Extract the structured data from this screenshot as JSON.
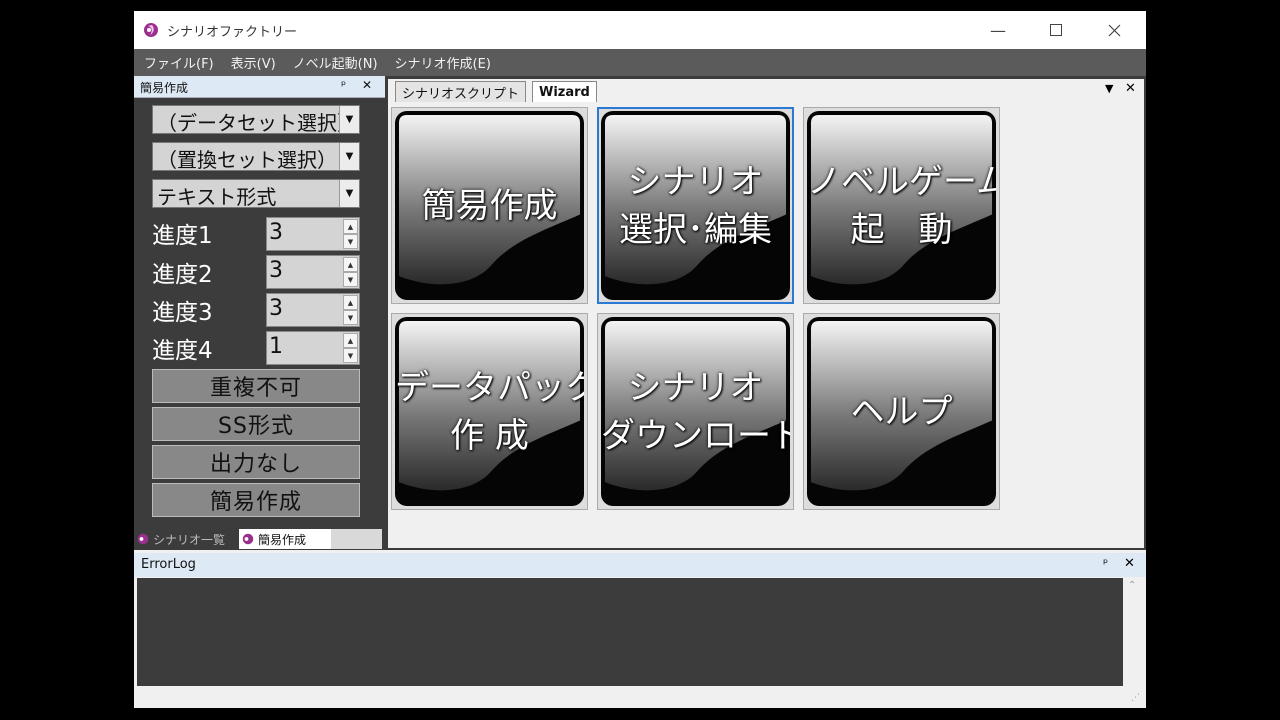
{
  "window": {
    "title": "シナリオファクトリー"
  },
  "menu": [
    "ファイル(F)",
    "表示(V)",
    "ノベル起動(N)",
    "シナリオ作成(E)"
  ],
  "left_pane": {
    "title": "簡易作成",
    "pin": "ᵖ",
    "close": "✕",
    "combos": [
      "（データセット選択）",
      "（置換セット選択）",
      "テキスト形式"
    ],
    "spinners": [
      {
        "label": "進度1",
        "value": "3"
      },
      {
        "label": "進度2",
        "value": "3"
      },
      {
        "label": "進度3",
        "value": "3"
      },
      {
        "label": "進度4",
        "value": "1"
      }
    ],
    "buttons": [
      "重複不可",
      "SS形式",
      "出力なし",
      "簡易作成"
    ],
    "tabs": [
      "シナリオ一覧",
      "簡易作成"
    ]
  },
  "main": {
    "tabs": [
      "シナリオスクリプト",
      "Wizard"
    ],
    "active_tab": "Wizard",
    "tiles": [
      {
        "line1": "簡易作成",
        "line2": ""
      },
      {
        "line1": "シナリオ",
        "line2": "選択･編集"
      },
      {
        "line1": "ノベルゲーム",
        "line2": "起　動"
      },
      {
        "line1": "データパック",
        "line2": "作 成"
      },
      {
        "line1": "シナリオ",
        "line2": "ダウンロード"
      },
      {
        "line1": "ヘルプ",
        "line2": ""
      }
    ]
  },
  "errorlog": {
    "title": "ErrorLog"
  },
  "colors": {
    "selection": "#2a7ad4",
    "menubar": "#5b5b5b",
    "pane_bg": "#3c3c3c"
  }
}
